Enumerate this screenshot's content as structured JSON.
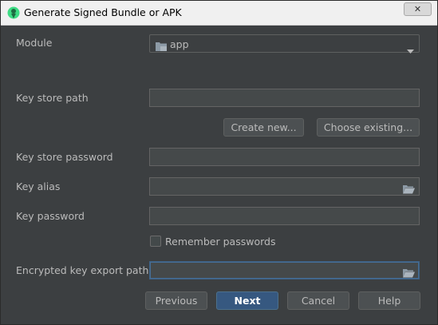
{
  "window": {
    "title": "Generate Signed Bundle or APK",
    "close_symbol": "✕",
    "icons": {
      "app": "android-studio-icon",
      "close": "close-icon"
    }
  },
  "module": {
    "label": "Module",
    "selected": "app",
    "icon": "folder-icon"
  },
  "key_store_path": {
    "label": "Key store path",
    "value": ""
  },
  "buttons": {
    "create_new": "Create new...",
    "choose_existing": "Choose existing...",
    "previous": "Previous",
    "next": "Next",
    "cancel": "Cancel",
    "help": "Help"
  },
  "key_store_password": {
    "label": "Key store password",
    "value": ""
  },
  "key_alias": {
    "label": "Key alias",
    "value": "",
    "icon": "browse-folder-icon"
  },
  "key_password": {
    "label": "Key password",
    "value": ""
  },
  "remember": {
    "label": "Remember passwords",
    "checked": false
  },
  "encrypted_path": {
    "label": "Encrypted key export path",
    "value": "",
    "icon": "browse-folder-icon"
  },
  "colors": {
    "background": "#3c3f41",
    "text": "#bbbbbb",
    "primary_button": "#365880",
    "focus_border": "#3d6185"
  }
}
